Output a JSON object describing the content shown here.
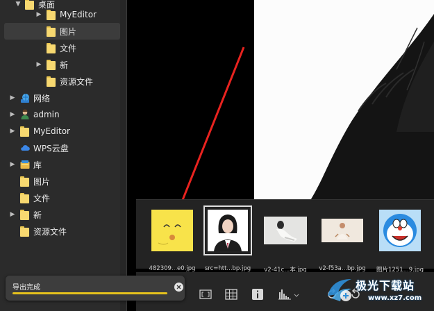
{
  "sidebar": {
    "items": [
      {
        "label": "桌面",
        "icon": "folder-icon",
        "expandable": true
      },
      {
        "label": "MyEditor",
        "icon": "folder-icon",
        "expandable": true
      },
      {
        "label": "图片",
        "icon": "folder-icon",
        "expandable": false,
        "selected": true
      },
      {
        "label": "文件",
        "icon": "folder-icon",
        "expandable": false
      },
      {
        "label": "新",
        "icon": "folder-icon",
        "expandable": true
      },
      {
        "label": "资源文件",
        "icon": "folder-icon",
        "expandable": false
      },
      {
        "label": "网络",
        "icon": "network-globe-icon",
        "expandable": true
      },
      {
        "label": "admin",
        "icon": "user-icon",
        "expandable": true
      },
      {
        "label": "MyEditor",
        "icon": "folder-icon",
        "expandable": true
      },
      {
        "label": "WPS云盘",
        "icon": "cloud-icon",
        "expandable": false
      },
      {
        "label": "库",
        "icon": "library-icon",
        "expandable": true
      },
      {
        "label": "图片",
        "icon": "folder-icon",
        "expandable": false
      },
      {
        "label": "文件",
        "icon": "folder-icon",
        "expandable": false
      },
      {
        "label": "新",
        "icon": "folder-icon",
        "expandable": true
      },
      {
        "label": "资源文件",
        "icon": "folder-icon",
        "expandable": false
      }
    ]
  },
  "thumbnails": [
    {
      "name": "482309...e0.jpg",
      "selected": false
    },
    {
      "name": "src=htt...bp.jpg",
      "selected": true
    },
    {
      "name": "v2-41c...本.jpg",
      "selected": false
    },
    {
      "name": "v2-f53a...bp.jpg",
      "selected": false
    },
    {
      "name": "图片1251...9.jpg",
      "selected": false
    }
  ],
  "toast": {
    "text": "导出完成",
    "progress": 1.0
  },
  "watermark": {
    "title": "极光下载站",
    "url": "www.xz7.com"
  },
  "colors": {
    "accent_arrow": "#e8231f",
    "progress_fill": "#e6c21d",
    "folder": "#f7d870"
  }
}
